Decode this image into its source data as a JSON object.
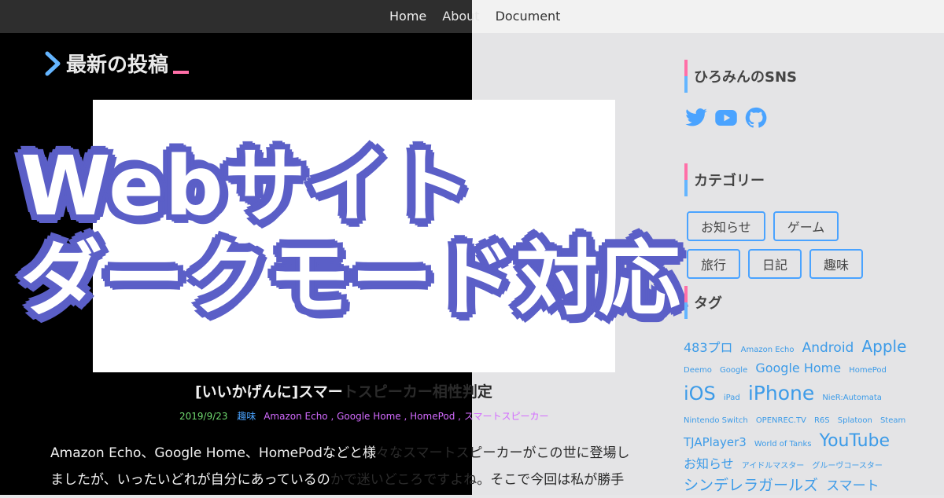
{
  "nav": {
    "home": "Home",
    "about": "About",
    "document": "Document"
  },
  "section": {
    "title": "最新の投稿"
  },
  "hero": {
    "line1": "Webサイト",
    "line2": "ダークモード対応"
  },
  "post": {
    "title_dark": "[いいかげんに]スマー",
    "title_light": "トスピーカー相性判定",
    "date": "2019/9/23",
    "category": "趣味",
    "tags": [
      "Amazon Echo",
      "Google Home",
      "HomePod",
      "スマートスピーカー"
    ],
    "line1_dark": "Amazon Echo、Google Home、HomePodなどと様",
    "line1_light": "々なスマートスピーカーがこの世に登場し",
    "line2_dark": "ましたが、いったいどれが自分にあっているの",
    "line2_light": "かで迷いどころですよね。そこで今回は私が勝手"
  },
  "sidebar": {
    "sns_title": "ひろみんのSNS",
    "sns_icons": [
      "twitter-icon",
      "youtube-icon",
      "github-icon"
    ],
    "category_title": "カテゴリー",
    "categories": [
      "お知らせ",
      "ゲーム",
      "旅行",
      "日記",
      "趣味"
    ],
    "tag_title": "タグ",
    "tags": [
      {
        "label": "483プロ",
        "size": 16
      },
      {
        "label": "Amazon Echo",
        "size": 10
      },
      {
        "label": "Android",
        "size": 17
      },
      {
        "label": "Apple",
        "size": 20
      },
      {
        "label": "Deemo",
        "size": 10
      },
      {
        "label": "Google",
        "size": 10
      },
      {
        "label": "Google Home",
        "size": 16
      },
      {
        "label": "HomePod",
        "size": 10
      },
      {
        "label": "iOS",
        "size": 24
      },
      {
        "label": "iPad",
        "size": 10
      },
      {
        "label": "iPhone",
        "size": 25
      },
      {
        "label": "NieR:Automata",
        "size": 10
      },
      {
        "label": "Nintendo Switch",
        "size": 10
      },
      {
        "label": "OPENREC.TV",
        "size": 10
      },
      {
        "label": "R6S",
        "size": 10
      },
      {
        "label": "Splatoon",
        "size": 10
      },
      {
        "label": "Steam",
        "size": 10
      },
      {
        "label": "TJAPlayer3",
        "size": 15
      },
      {
        "label": "World of Tanks",
        "size": 10
      },
      {
        "label": "YouTube",
        "size": 22
      },
      {
        "label": "お知らせ",
        "size": 16
      },
      {
        "label": "アイドルマスター",
        "size": 10
      },
      {
        "label": "グルーヴコースター",
        "size": 10
      },
      {
        "label": "シンデレラガールズ",
        "size": 19
      },
      {
        "label": "スマート",
        "size": 17
      }
    ]
  },
  "colors": {
    "accent_blue": "#4aa3ff",
    "accent_pink": "#ff6fa8",
    "title_outline": "#5b5fc7",
    "tag_text": "#3c9be8"
  }
}
